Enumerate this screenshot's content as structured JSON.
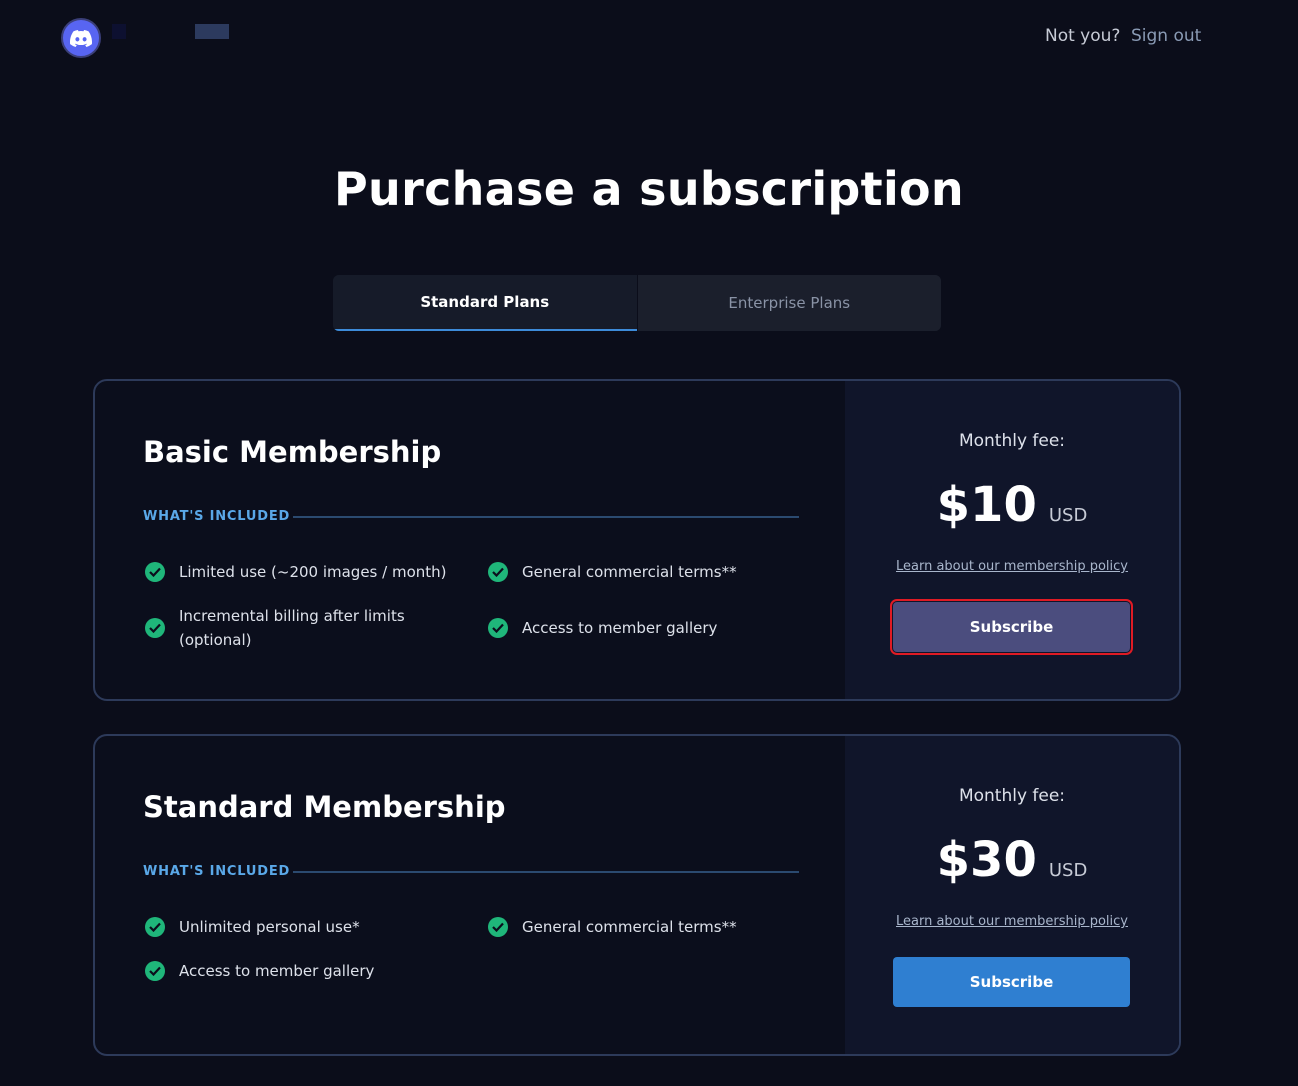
{
  "header": {
    "not_you": "Not you?",
    "sign_out": "Sign out",
    "icon": "discord-logo-icon"
  },
  "page": {
    "title": "Purchase a subscription"
  },
  "tabs": [
    {
      "label": "Standard Plans",
      "active": true
    },
    {
      "label": "Enterprise Plans",
      "active": false
    }
  ],
  "plans": [
    {
      "name": "Basic Membership",
      "included_label": "WHAT'S INCLUDED",
      "features": [
        "Limited use (~200 images / month)",
        "General commercial terms**",
        "Incremental billing after limits (optional)",
        "Access to member gallery"
      ],
      "fee_label": "Monthly fee:",
      "price": "$10",
      "currency": "USD",
      "policy_link": "Learn about our membership policy",
      "subscribe_label": "Subscribe"
    },
    {
      "name": "Standard Membership",
      "included_label": "WHAT'S INCLUDED",
      "features": [
        "Unlimited personal use*",
        "General commercial terms**",
        "Access to member gallery"
      ],
      "fee_label": "Monthly fee:",
      "price": "$30",
      "currency": "USD",
      "policy_link": "Learn about our membership policy",
      "subscribe_label": "Subscribe"
    }
  ],
  "colors": {
    "background": "#0b0d1a",
    "accent": "#3d8bd9",
    "check": "#1fb67a",
    "subscribe_highlight": "#4b4d7e",
    "subscribe_normal": "#2f7fd1"
  }
}
